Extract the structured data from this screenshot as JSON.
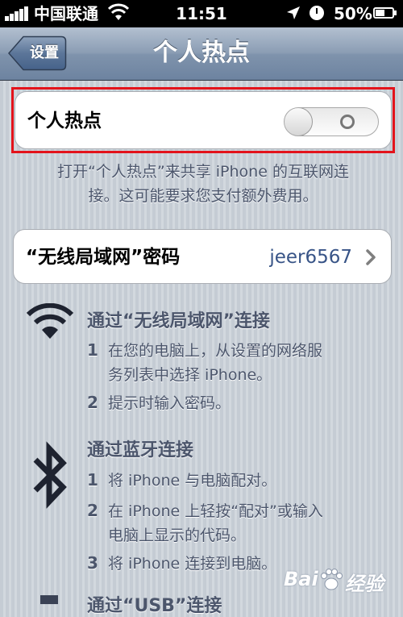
{
  "status_bar": {
    "carrier": "中国联通",
    "time": "11:51",
    "battery": "50%",
    "battery_level": 0.5
  },
  "nav": {
    "back_label": "设置",
    "title": "个人热点"
  },
  "hotspot": {
    "label": "个人热点",
    "toggle_state": "off",
    "description_line1": "打开“个人热点”来共享 iPhone 的互联网连",
    "description_line2": "接。这可能要求您支付额外费用。"
  },
  "wifi_password": {
    "label": "“无线局域网”密码",
    "value": "jeer6567"
  },
  "sections": {
    "wifi": {
      "title": "通过“无线局域网”连接",
      "step1_num": "1",
      "step1_line1": "在您的电脑上，从设置的网络服",
      "step1_line2": "务列表中选择 iPhone。",
      "step2_num": "2",
      "step2_line1": "提示时输入密码。"
    },
    "bluetooth": {
      "title": "通过蓝牙连接",
      "step1_num": "1",
      "step1_line1": "将 iPhone 与电脑配对。",
      "step2_num": "2",
      "step2_line1": "在 iPhone 上轻按“配对”或输入",
      "step2_line2": "电脑上显示的代码。",
      "step3_num": "3",
      "step3_line1": "将 iPhone 连接到电脑。"
    },
    "usb": {
      "title": "通过“USB”连接"
    }
  },
  "watermark": {
    "text_a": "Bai",
    "text_b": "经验"
  },
  "colors": {
    "accent_value": "#385487",
    "highlight_box": "#e3131b",
    "secondary_text": "#4c566c"
  },
  "icons": [
    "signal-bars-icon",
    "wifi-icon",
    "location-arrow-icon",
    "clock-icon",
    "battery-icon",
    "back-arrow-icon",
    "chevron-right-icon",
    "wifi-large-icon",
    "bluetooth-icon",
    "usb-icon",
    "paw-icon"
  ]
}
